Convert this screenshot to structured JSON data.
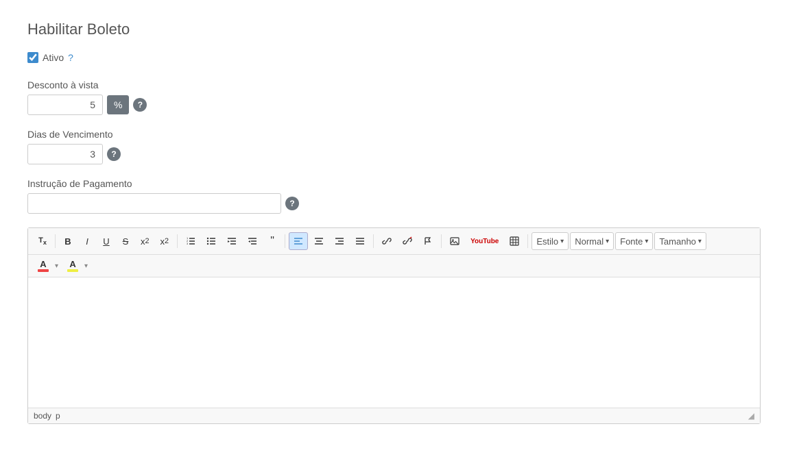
{
  "page": {
    "title": "Habilitar Boleto"
  },
  "ativo": {
    "label": "Ativo",
    "link_text": "?",
    "checked": true
  },
  "desconto": {
    "label": "Desconto à vista",
    "value": "5",
    "unit": "%"
  },
  "vencimento": {
    "label": "Dias de Vencimento",
    "value": "3"
  },
  "instrucao": {
    "label": "Instrução de Pagamento",
    "placeholder": ""
  },
  "toolbar": {
    "clear_format": "Tx",
    "bold": "B",
    "italic": "I",
    "underline": "U",
    "strikethrough": "S",
    "subscript": "x₂",
    "superscript": "x²",
    "ol": "≡",
    "ul": "≡",
    "indent_more": "≡",
    "indent_less": "≡",
    "blockquote": "❞",
    "align_left": "≡",
    "align_center": "≡",
    "align_right": "≡",
    "align_justify": "≡",
    "link": "🔗",
    "unlink": "🔗",
    "flag": "⚑",
    "image": "🖼",
    "video": "▶",
    "table": "⊞",
    "estilo_label": "Estilo",
    "normal_label": "Normal",
    "fonte_label": "Fonte",
    "tamanho_label": "Tamanho",
    "font_color_letter": "A",
    "bg_color_letter": "A"
  },
  "footer": {
    "body_label": "body",
    "p_label": "p"
  }
}
